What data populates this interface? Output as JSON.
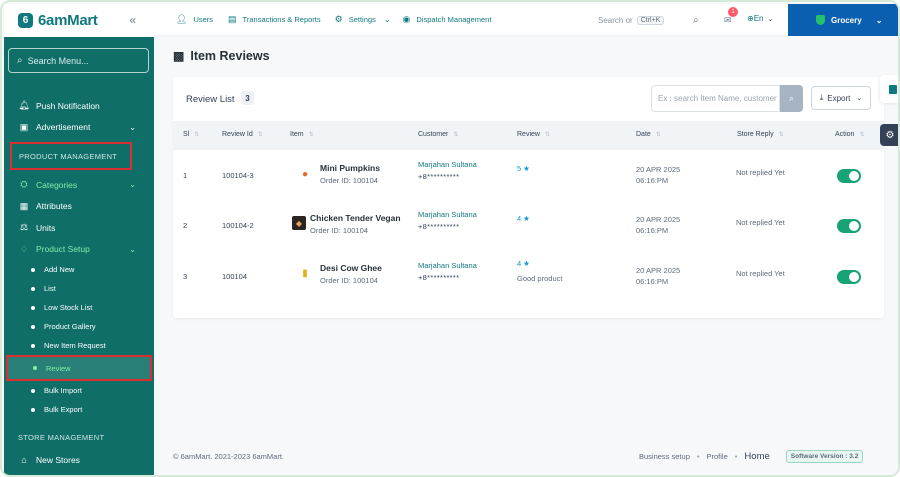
{
  "brand": {
    "name": "6amMart",
    "collapse_icon": "chevron-double-left-icon"
  },
  "sidebar": {
    "search_placeholder": "Search Menu...",
    "items": [
      {
        "label": "Push Notification",
        "icon": "bell-icon"
      },
      {
        "label": "Advertisement",
        "icon": "ad-icon",
        "has_chevron": true
      }
    ],
    "section_product": "PRODUCT MANAGEMENT",
    "product_items": [
      {
        "label": "Categories",
        "icon": "category-icon",
        "has_chevron": true
      },
      {
        "label": "Attributes",
        "icon": "attribute-icon"
      },
      {
        "label": "Units",
        "icon": "unit-icon"
      },
      {
        "label": "Product Setup",
        "icon": "product-setup-icon",
        "has_chevron": true
      }
    ],
    "product_setup_sub": [
      {
        "label": "Add New"
      },
      {
        "label": "List"
      },
      {
        "label": "Low Stock List"
      },
      {
        "label": "Product Gallery"
      },
      {
        "label": "New Item Request"
      },
      {
        "label": "Review",
        "active": true
      },
      {
        "label": "Bulk Import"
      },
      {
        "label": "Bulk Export"
      }
    ],
    "section_store": "STORE MANAGEMENT",
    "store_items": [
      {
        "label": "New Stores",
        "icon": "store-icon"
      }
    ]
  },
  "topbar": {
    "nav": [
      {
        "label": "Users",
        "icon": "user-icon"
      },
      {
        "label": "Transactions & Reports",
        "icon": "report-icon"
      },
      {
        "label": "Settings",
        "icon": "gear-icon",
        "has_chevron": true
      },
      {
        "label": "Dispatch Management",
        "icon": "dispatch-icon"
      }
    ],
    "search_label": "Search or",
    "search_shortcut": "Ctrl+K",
    "message_badge": "1",
    "language": "En",
    "module": "Grocery"
  },
  "page": {
    "title": "Item Reviews",
    "review_list_label": "Review List",
    "review_count": "3",
    "search_placeholder": "Ex : search Item Name, customer",
    "export_label": "Export"
  },
  "table": {
    "headers": [
      "Sl",
      "Review Id",
      "Item",
      "Customer",
      "Review",
      "Date",
      "Store Reply",
      "Action"
    ],
    "rows": [
      {
        "sl": "1",
        "review_id": "100104-3",
        "item_name": "Mini Pumpkins",
        "order_id": "Order ID: 100104",
        "customer": "Marjahan Sultana",
        "phone": "+8**********",
        "rating": "5",
        "review_text": "",
        "date": "20 APR 2025",
        "time": "06:16:PM",
        "reply": "Not replied Yet",
        "status_on": true,
        "thumb": "pumpkin"
      },
      {
        "sl": "2",
        "review_id": "100104-2",
        "item_name": "Chicken Tender Vegan",
        "order_id": "Order ID: 100104",
        "customer": "Marjahan Sultana",
        "phone": "+8**********",
        "rating": "4",
        "review_text": "",
        "date": "20 APR 2025",
        "time": "06:16:PM",
        "reply": "Not replied Yet",
        "status_on": true,
        "thumb": "chicken"
      },
      {
        "sl": "3",
        "review_id": "100104",
        "item_name": "Desi Cow Ghee",
        "order_id": "Order ID: 100104",
        "customer": "Marjahan Sultana",
        "phone": "+8**********",
        "rating": "4",
        "review_text": "Good product",
        "date": "20 APR 2025",
        "time": "06:16:PM",
        "reply": "Not replied Yet",
        "status_on": true,
        "thumb": "ghee"
      }
    ]
  },
  "footer": {
    "copyright": "© 6amMart. 2021-2023 6amMart.",
    "links": [
      "Business setup",
      "Profile",
      "Home"
    ],
    "version": "Software Version : 3.2"
  },
  "colors": {
    "primary": "#107980",
    "sidebar_bg": "#106e68",
    "module_bg": "#0a5fb0",
    "highlight_border": "#d9302f",
    "toggle_on": "#17a376"
  }
}
